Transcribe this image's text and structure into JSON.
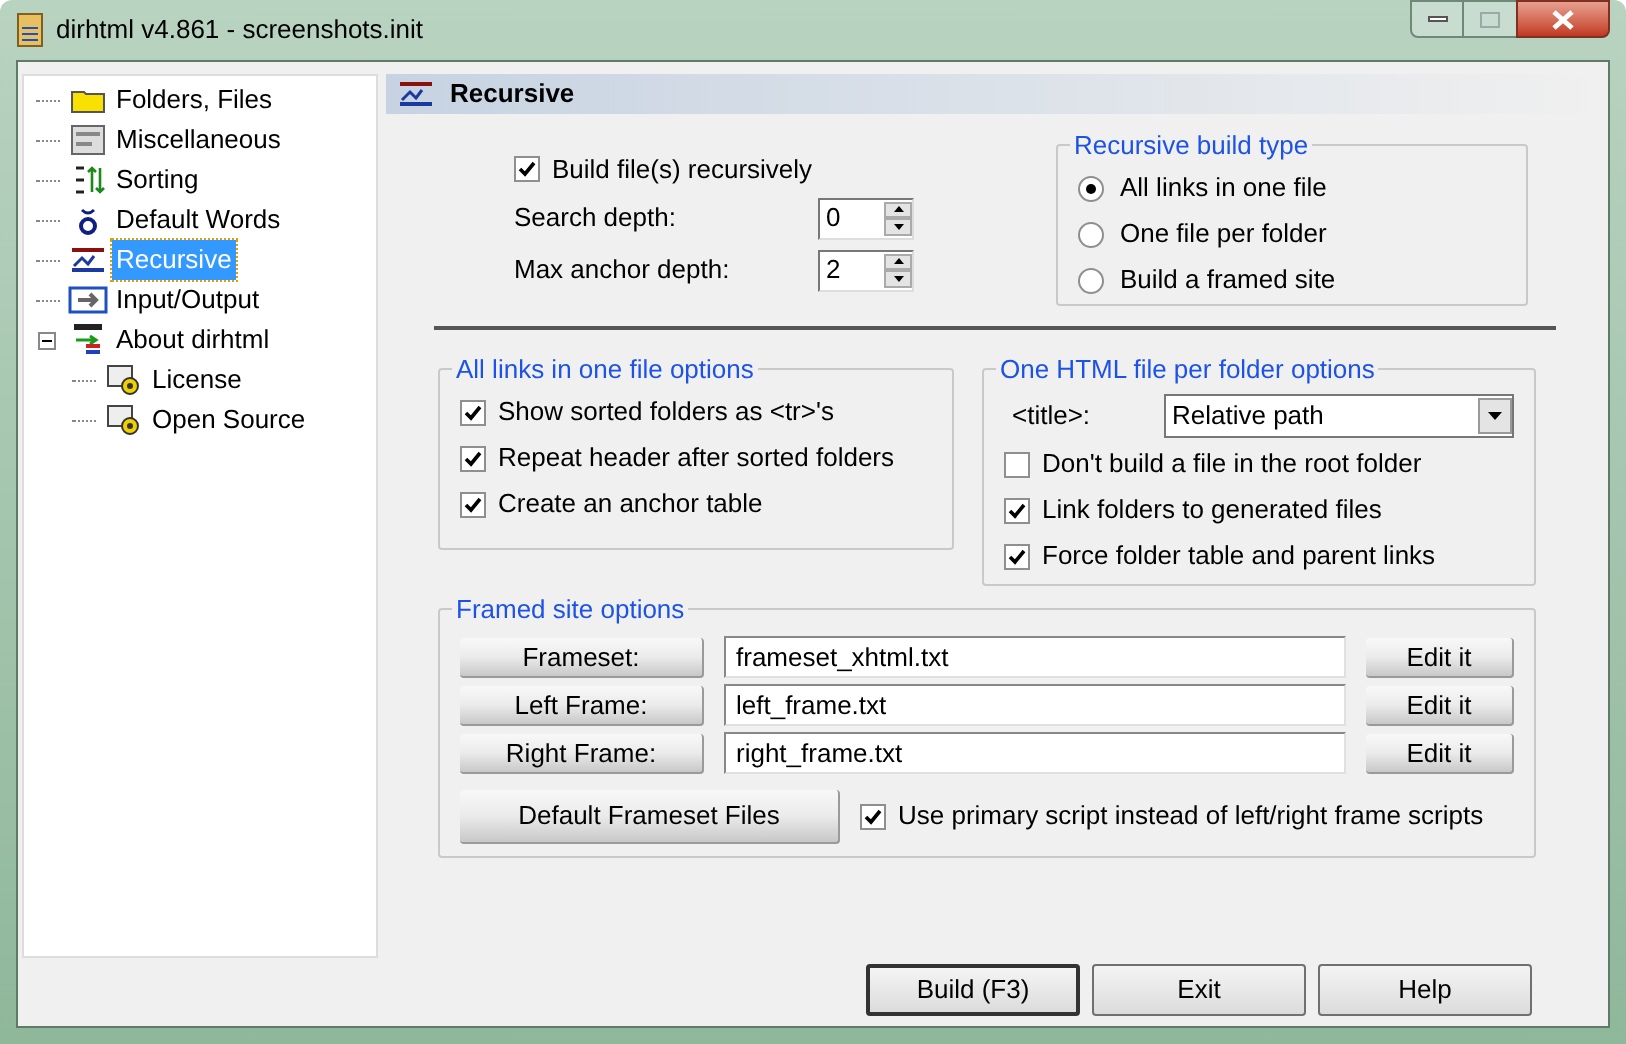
{
  "window": {
    "title": "dirhtml v4.861 - screenshots.init"
  },
  "tree": [
    {
      "label": "Folders, Files",
      "selected": false
    },
    {
      "label": "Miscellaneous",
      "selected": false
    },
    {
      "label": "Sorting",
      "selected": false
    },
    {
      "label": "Default Words",
      "selected": false
    },
    {
      "label": "Recursive",
      "selected": true
    },
    {
      "label": "Input/Output",
      "selected": false
    },
    {
      "label": "About dirhtml",
      "selected": false,
      "expanded": true,
      "children": [
        {
          "label": "License",
          "selected": false
        },
        {
          "label": "Open Source",
          "selected": false
        }
      ]
    }
  ],
  "section": {
    "title": "Recursive"
  },
  "build_recursively": {
    "label": "Build file(s) recursively",
    "checked": true
  },
  "spinners": [
    {
      "label": "Search depth:",
      "value": "0"
    },
    {
      "label": "Max anchor depth:",
      "value": "2"
    }
  ],
  "build_type": {
    "title": "Recursive build type",
    "options": [
      {
        "label": "All links in one file",
        "selected": true
      },
      {
        "label": "One file per folder",
        "selected": false
      },
      {
        "label": "Build a framed site",
        "selected": false
      }
    ]
  },
  "one_file_options": {
    "title": "All links in one file options",
    "checkboxes": [
      {
        "label": "Show sorted folders as <tr>'s",
        "checked": true
      },
      {
        "label": "Repeat header after sorted folders",
        "checked": true
      },
      {
        "label": "Create an anchor table",
        "checked": true
      }
    ]
  },
  "per_folder_options": {
    "title": "One HTML file per folder options",
    "title_field": {
      "label": "<title>:",
      "value": "Relative path"
    },
    "checkboxes": [
      {
        "label": "Don't build a file in the root folder",
        "checked": false
      },
      {
        "label": "Link folders to generated files",
        "checked": true
      },
      {
        "label": "Force folder table and parent links",
        "checked": true
      }
    ]
  },
  "framed_site": {
    "title": "Framed site options",
    "rows": [
      {
        "button": "Frameset:",
        "value": "frameset_xhtml.txt",
        "edit": "Edit it"
      },
      {
        "button": "Left Frame:",
        "value": "left_frame.txt",
        "edit": "Edit it"
      },
      {
        "button": "Right Frame:",
        "value": "right_frame.txt",
        "edit": "Edit it"
      }
    ],
    "default_button": "Default Frameset Files",
    "checkbox": {
      "label": "Use primary script instead of left/right frame scripts",
      "checked": true
    }
  },
  "buttons": [
    "Build (F3)",
    "Exit",
    "Help"
  ]
}
